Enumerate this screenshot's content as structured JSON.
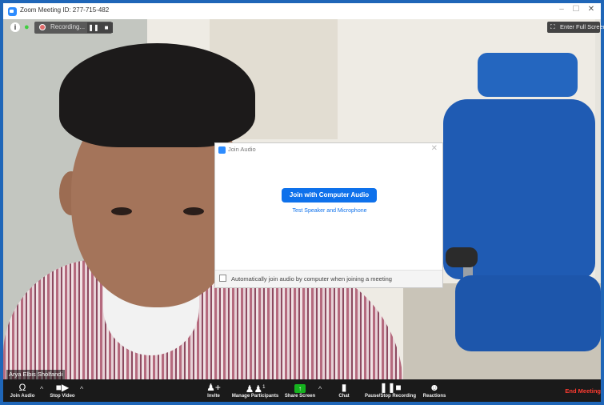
{
  "window": {
    "title": "Zoom Meeting ID: 277-715-482",
    "minimize": "–",
    "maximize": "☐",
    "close": "✕"
  },
  "top_toolbar": {
    "info_icon": "i",
    "lock_icon": "🔒",
    "recording_label": "Recording...",
    "pause_label": "❚❚",
    "stop_label": "■",
    "fullscreen_icon": "⛶",
    "fullscreen_label": "Enter Full Screen"
  },
  "video": {
    "participant_name": "Arya Elbis Sholfandi"
  },
  "join_audio_dialog": {
    "title": "Join Audio",
    "close": "✕",
    "join_button": "Join with Computer Audio",
    "test_link": "Test Speaker and Microphone",
    "auto_join_label": "Automatically join audio by computer when joining a meeting",
    "auto_join_checked": false
  },
  "bottom_toolbar": {
    "join_audio": "Join Audio",
    "stop_video": "Stop Video",
    "invite": "Invite",
    "manage_participants": "Manage Participants",
    "participant_count": "1",
    "share_screen": "Share Screen",
    "chat": "Chat",
    "pause_stop_recording": "Pause/Stop Recording",
    "reactions": "Reactions",
    "end_meeting": "End Meeting",
    "caret": "^"
  },
  "colors": {
    "window_frame": "#1f66b8",
    "zoom_blue": "#0e71eb",
    "end_red": "#ff3b30",
    "share_green": "#15b21e",
    "toolbar_bg": "#1a1a1a"
  }
}
